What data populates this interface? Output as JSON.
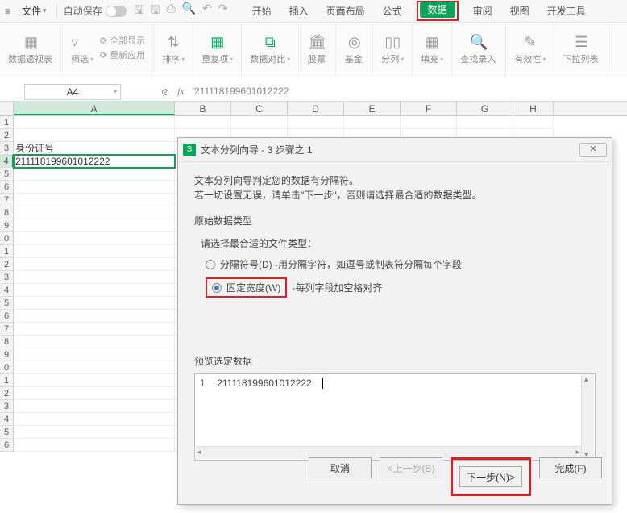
{
  "menubar": {
    "file": "文件",
    "autosave": "自动保存"
  },
  "tabs": {
    "start": "开始",
    "insert": "插入",
    "layout": "页面布局",
    "formula": "公式",
    "data": "数据",
    "review": "审阅",
    "view": "视图",
    "dev": "开发工具"
  },
  "ribbon": {
    "pivot": "数据透视表",
    "filter": "筛选",
    "showall": "全部显示",
    "reapply": "重新应用",
    "sort": "排序",
    "dedup": "重复项",
    "compare": "数据对比",
    "stocks": "股票",
    "funds": "基金",
    "split": "分列",
    "fill": "填充",
    "findrec": "查找录入",
    "validity": "有效性",
    "dropdown": "下拉列表"
  },
  "cellref": "A4",
  "formula_prefix": "'",
  "formula_val": "211118199601012222",
  "columns": [
    "A",
    "B",
    "C",
    "D",
    "E",
    "F",
    "G",
    "H"
  ],
  "col_widths": {
    "A": 200,
    "B": 70,
    "C": 70,
    "D": 70,
    "E": 70,
    "F": 70,
    "G": 70,
    "H": 50
  },
  "row_labels": [
    "1",
    "2",
    "3",
    "4",
    "5",
    "6",
    "7",
    "8",
    "9",
    "0",
    "1",
    "2",
    "3",
    "4",
    "5",
    "6",
    "7",
    "8",
    "9",
    "0",
    "1",
    "2",
    "3",
    "4",
    "5",
    "6"
  ],
  "cells": {
    "A3": "身份证号",
    "A4": "211118199601012222"
  },
  "dialog": {
    "title": "文本分列向导 - 3 步骤之 1",
    "line1": "文本分列向导判定您的数据有分隔符。",
    "line2": "若一切设置无误，请单击\"下一步\"，否则请选择最合适的数据类型。",
    "group_label": "原始数据类型",
    "choose_label": "请选择最合适的文件类型：",
    "radio1": "分隔符号(D)   -用分隔字符，如逗号或制表符分隔每个字段",
    "radio2_a": "固定宽度(W)",
    "radio2_b": "-每列字段加空格对齐",
    "preview_label": "预览选定数据",
    "preview_line": "211118199601012222",
    "btn_cancel": "取消",
    "btn_prev": "<上一步(B)",
    "btn_next": "下一步(N)>",
    "btn_finish": "完成(F)"
  }
}
